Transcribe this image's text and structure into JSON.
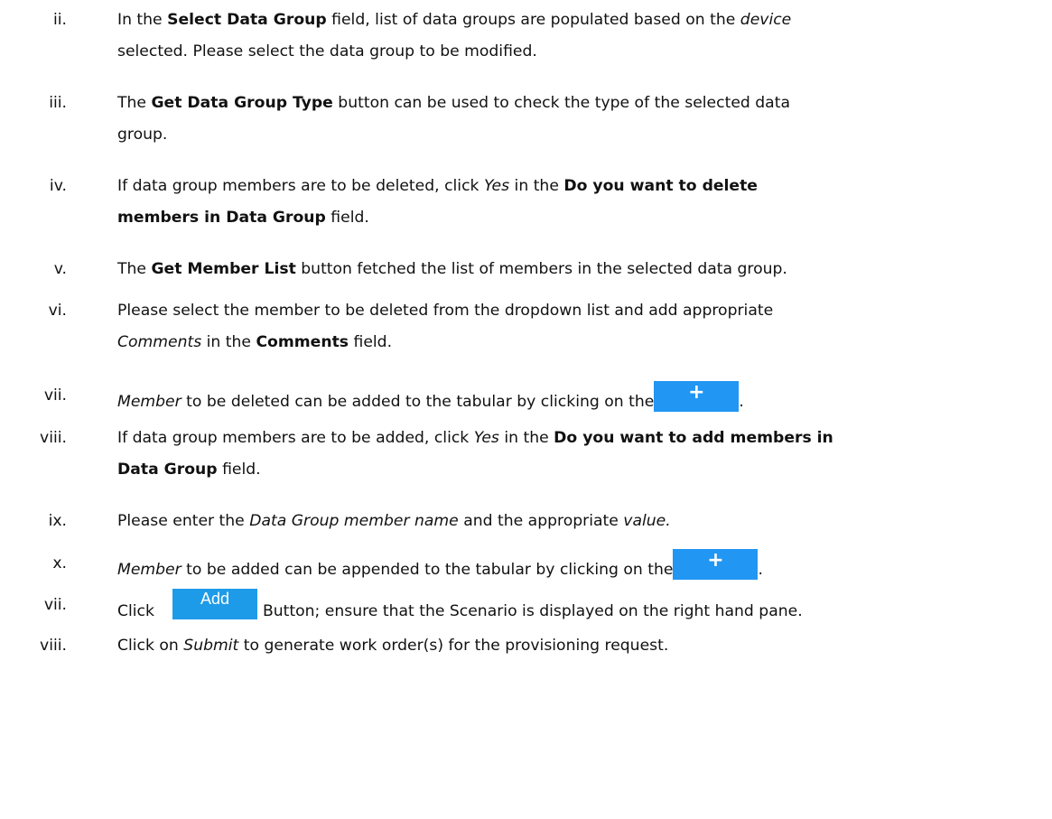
{
  "items": [
    {
      "num": "ii.",
      "line1": {
        "a": "In the ",
        "b1": "Select Data Group",
        "c": " field, list of data groups are populated based on the ",
        "i1": "device"
      },
      "line2": "selected. Please select the data group to be modified."
    },
    {
      "num": "iii.",
      "line1": {
        "a": "The ",
        "b1": "Get Data Group Type",
        "c": " button can be used to check the type of the selected data"
      },
      "line2": "group."
    },
    {
      "num": "iv.",
      "line1": {
        "a": "If data group members are to be deleted, click ",
        "i1": "Yes",
        "c": " in the ",
        "b1": "Do you want to delete"
      },
      "line2b": "members in Data Group",
      "line2c": " field."
    },
    {
      "num": "v.",
      "line1": {
        "a": "The ",
        "b1": "Get Member List",
        "c": " button fetched the list of members in the selected data group."
      }
    },
    {
      "num": "vi.",
      "line1": {
        "a": "Please select the member to be deleted from the dropdown list and add appropriate"
      },
      "line2i": "Comments",
      "line2a": " in the ",
      "line2b": "Comments",
      "line2c": " field."
    },
    {
      "num": "vii.",
      "line1": {
        "i1": "Member",
        "a": " to be deleted can be added to the tabular by clicking on the",
        "end": "."
      }
    },
    {
      "num": "viii.",
      "line1": {
        "a": "If data group members are to be added, click ",
        "i1": "Yes",
        "c": " in the ",
        "b1": "Do you want to add members in"
      },
      "line2b": "Data Group",
      "line2c": " field."
    },
    {
      "num": "ix.",
      "line1": {
        "a": "Please enter the ",
        "i1": "Data Group member name",
        "c": " and the appropriate ",
        "i2": "value."
      }
    },
    {
      "num": "x.",
      "line1": {
        "i1": "Member",
        "a": " to be added can be appended to the tabular by clicking on the",
        "end": "."
      }
    },
    {
      "num": "vii.",
      "line1": {
        "a": "Click",
        "c": "Button; ensure that the Scenario is displayed on the right hand pane."
      }
    },
    {
      "num": "viii.",
      "line1": {
        "a": "Click on ",
        "i1": "Submit",
        "c": " to generate work order(s) for the provisioning request."
      }
    }
  ],
  "buttons": {
    "plus": "+",
    "add": "Add"
  },
  "colors": {
    "button_blue": "#2196f3"
  }
}
